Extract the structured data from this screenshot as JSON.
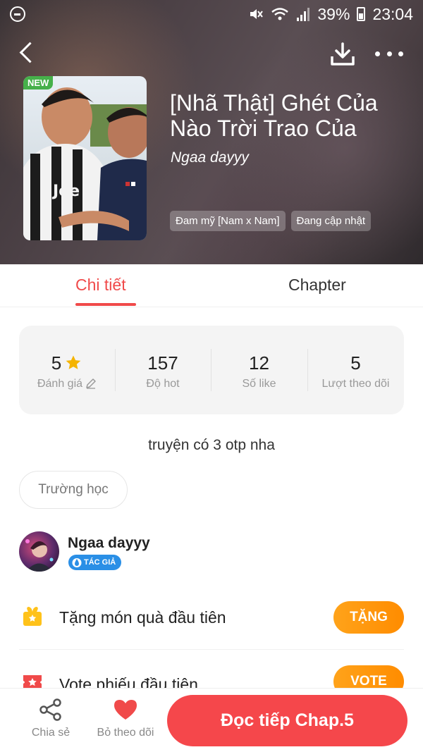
{
  "status_bar": {
    "battery": "39%",
    "time": "23:04"
  },
  "story": {
    "badge": "NEW",
    "title": "[Nhã Thật] Ghét Của Nào Trời Trao Của",
    "author": "Ngaa dayyy",
    "tags": [
      "Đam mỹ [Nam x Nam]",
      "Đang cập nhật"
    ],
    "description": "truyện có 3 otp nha",
    "genre": "Trường học"
  },
  "tabs": {
    "detail": "Chi tiết",
    "chapter": "Chapter"
  },
  "stats": [
    {
      "value": "5",
      "label": "Đánh giá"
    },
    {
      "value": "157",
      "label": "Độ hot"
    },
    {
      "value": "12",
      "label": "Số like"
    },
    {
      "value": "5",
      "label": "Lượt theo dõi"
    }
  ],
  "author_card": {
    "name": "Ngaa dayyy",
    "role_badge": "TÁC GIẢ"
  },
  "actions": {
    "gift_text": "Tặng món quà đầu tiên",
    "gift_button": "TẶNG",
    "vote_text": "Vote phiếu đầu tiên",
    "vote_button": "VOTE"
  },
  "bottom_bar": {
    "share_label": "Chia sẻ",
    "follow_label": "Bỏ theo dõi",
    "read_button": "Đọc tiếp Chap.5"
  },
  "colors": {
    "accent": "#f04a4a",
    "read_button": "#f5474b",
    "action_button": "#ff9a10",
    "badge_new": "#46b04a",
    "author_badge": "#2a8fe6"
  },
  "icons": {
    "back": "back-arrow-icon",
    "download": "download-icon",
    "more": "more-dots-icon",
    "star": "star-icon",
    "edit": "pencil-icon",
    "gift": "gift-icon",
    "vote": "vote-ticket-icon",
    "share": "share-icon",
    "heart": "heart-icon"
  }
}
